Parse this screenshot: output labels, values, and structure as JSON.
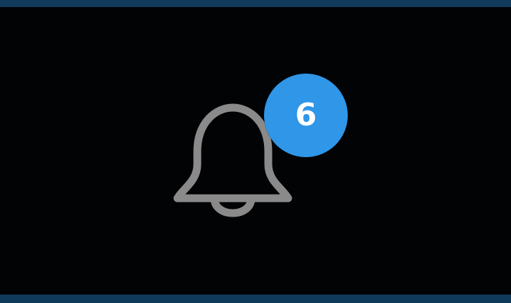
{
  "notification": {
    "count": "6",
    "icon": "bell-icon",
    "badge_color": "#2f96e8",
    "icon_color": "#8a8a8a",
    "background_color": "#020305",
    "frame_color": "#0f3a5a"
  }
}
